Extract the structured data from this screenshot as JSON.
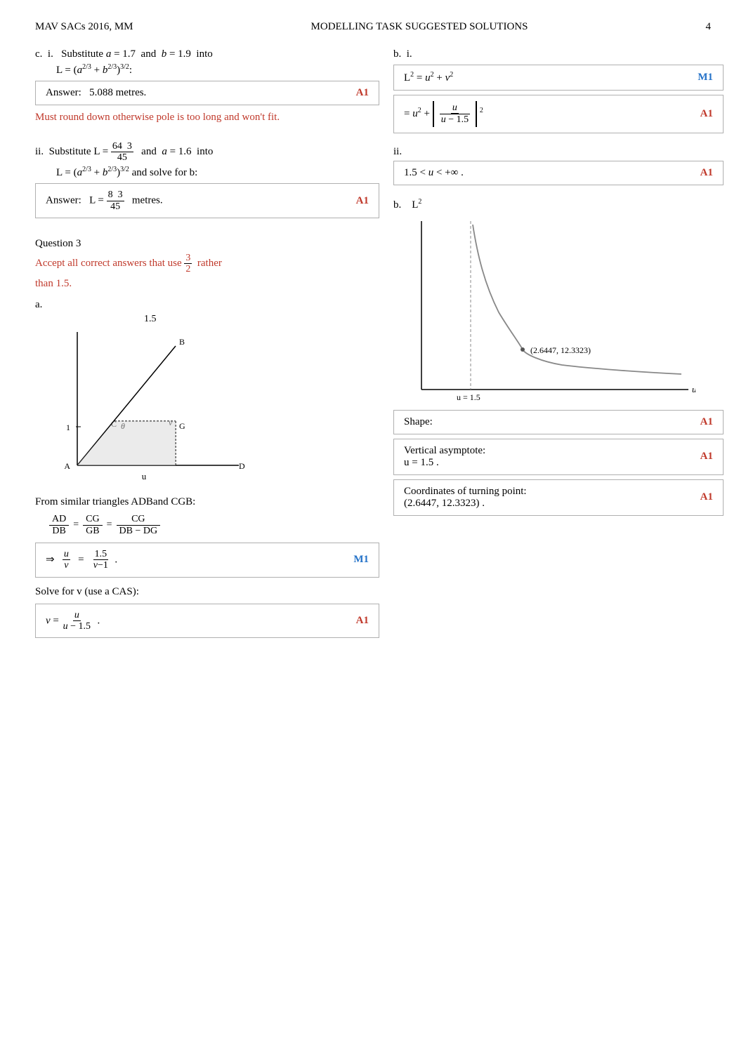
{
  "header": {
    "left": "MAV SACs 2016, MM",
    "center": "MODELLING TASK SUGGESTED SOLUTIONS",
    "page": "4"
  },
  "left_col": {
    "c_i_label": "c.  i.   Substitute",
    "c_i_cond": "a = 1.7  and  b = 1.9  into",
    "c_i_formula": "L = (a²/³ + b²/³)³/²:",
    "c_i_answer_label": "Answer:",
    "c_i_answer_val": "5.088 metres.",
    "c_i_mark": "A1",
    "c_i_note": "Must round down otherwise pole is too long and won't fit.",
    "c_ii_label": "ii.  Substitute L =",
    "c_ii_num": "64",
    "c_ii_num2": "3",
    "c_ii_den": "45",
    "c_ii_cond": " and  a = 1.6  into",
    "c_ii_formula": "L = (a²/³ + b²/³)³/² and solve for b:",
    "c_ii_answer_label": "Answer:",
    "c_ii_answer_val_pre": "L =",
    "c_ii_answer_num": "8",
    "c_ii_answer_num2": "3",
    "c_ii_answer_den": "45",
    "c_ii_answer_unit": "metres.",
    "c_ii_mark": "A1",
    "q3_label": "Question 3",
    "q3_note_pre": "Accept all correct answers that use",
    "q3_note_frac_num": "3",
    "q3_note_frac_den": "2",
    "q3_note_post": "rather",
    "q3_note_post2": "than 1.5.",
    "a_label": "a.",
    "a_graph_axis_u": "u",
    "a_graph_val_15": "1.5",
    "a_graph_val_1": "1",
    "a_graph_label_B": "B",
    "a_graph_label_C": "C",
    "a_graph_label_G": "G",
    "a_graph_label_A": "A",
    "a_graph_label_D": "D",
    "a_graph_theta": "θ",
    "a_graph_v": "v",
    "similar_triangles": "From similar triangles ADBand CGB:",
    "eq1_left": "AD",
    "eq1_mid": "CG",
    "eq1_right": "CG",
    "eq1_left_d": "DB",
    "eq1_mid_d": "GB",
    "eq1_right_d": "DB − DG",
    "eq2": "⇒",
    "eq2_u": "u",
    "eq2_v": "v",
    "eq2_15": "1.5",
    "eq2_v1": "v−1",
    "eq2_mark": "M1",
    "solve_label": "Solve for v (use a CAS):",
    "eq3_v": "v =",
    "eq3_u": "u",
    "eq3_denom": "u − 1.5",
    "eq3_mark": "A1"
  },
  "right_col": {
    "b_i_label": "b.  i.",
    "eq1": "L² = u² + v²",
    "eq1_mark": "M1",
    "eq2_text": "= u² +",
    "eq2_matrix_r1c1": "Ν",
    "eq2_matrix_r1c2": "u",
    "eq2_matrix_r2c1": "Νu",
    "eq2_matrix_r2c2": "−1.5Π",
    "eq2_mark": "A1",
    "b_ii_label": "ii.",
    "eq3": "1.5 < u < +∞.",
    "eq3_mark": "A1",
    "b_label": "b.",
    "graph_L2_label": "L²",
    "graph_coords": "(2.6447,  12.3323)",
    "graph_u_label": "u",
    "graph_asymptote_label": "u = 1.5",
    "shape_label": "Shape:",
    "shape_mark": "A1",
    "vert_asymptote_label": "Vertical asymptote:",
    "vert_asymptote_val": "u = 1.5 .",
    "vert_asymptote_mark": "A1",
    "turning_point_label": "Coordinates of turning point:",
    "turning_point_val": "(2.6447,  12.3323) .",
    "turning_point_mark": "A1"
  }
}
